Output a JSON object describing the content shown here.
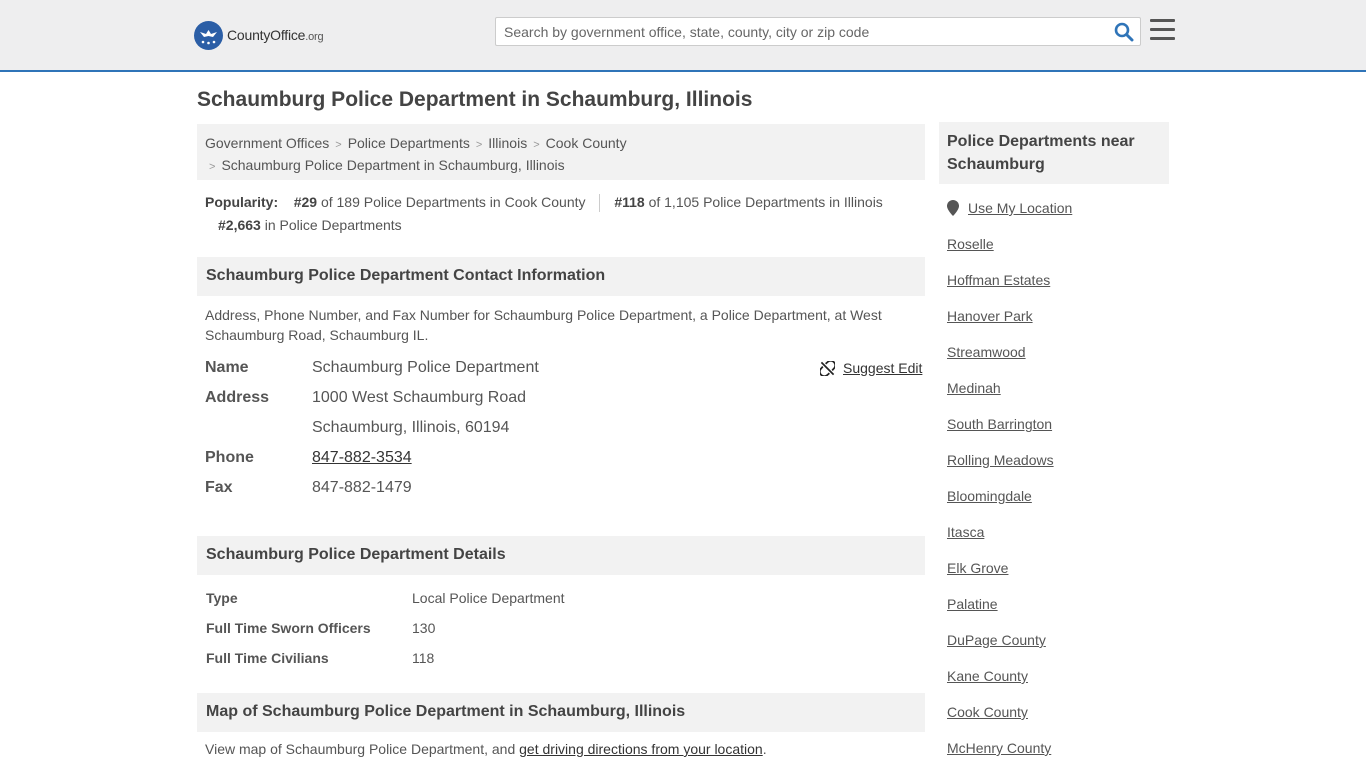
{
  "header": {
    "logo_text": "CountyOffice",
    "logo_suffix": ".org",
    "search_placeholder": "Search by government office, state, county, city or zip code"
  },
  "page_title": "Schaumburg Police Department in Schaumburg, Illinois",
  "breadcrumb": {
    "items": [
      "Government Offices",
      "Police Departments",
      "Illinois",
      "Cook County"
    ],
    "current": "Schaumburg Police Department in Schaumburg, Illinois"
  },
  "popularity": {
    "label": "Popularity:",
    "rank1": "#29",
    "rank1_text": "of 189 Police Departments in Cook County",
    "rank2": "#118",
    "rank2_text": "of 1,105 Police Departments in Illinois",
    "rank3": "#2,663",
    "rank3_text": "in Police Departments"
  },
  "contact": {
    "heading": "Schaumburg Police Department Contact Information",
    "intro": "Address, Phone Number, and Fax Number for Schaumburg Police Department, a Police Department, at West Schaumburg Road, Schaumburg IL.",
    "suggest_edit": "Suggest Edit",
    "name_label": "Name",
    "name": "Schaumburg Police Department",
    "address_label": "Address",
    "address_line1": "1000 West Schaumburg Road",
    "address_line2": "Schaumburg, Illinois, 60194",
    "phone_label": "Phone",
    "phone": "847-882-3534",
    "fax_label": "Fax",
    "fax": "847-882-1479"
  },
  "details": {
    "heading": "Schaumburg Police Department Details",
    "rows": [
      {
        "label": "Type",
        "value": "Local Police Department"
      },
      {
        "label": "Full Time Sworn Officers",
        "value": "130"
      },
      {
        "label": "Full Time Civilians",
        "value": "118"
      }
    ]
  },
  "map": {
    "heading": "Map of Schaumburg Police Department in Schaumburg, Illinois",
    "text_prefix": "View map of Schaumburg Police Department, and",
    "link": "get driving directions from your location",
    "text_suffix": "."
  },
  "sidebar": {
    "heading": "Police Departments near Schaumburg",
    "use_location": "Use My Location",
    "items": [
      "Roselle",
      "Hoffman Estates",
      "Hanover Park",
      "Streamwood",
      "Medinah",
      "South Barrington",
      "Rolling Meadows",
      "Bloomingdale",
      "Itasca",
      "Elk Grove",
      "Palatine",
      "DuPage County",
      "Kane County",
      "Cook County",
      "McHenry County"
    ]
  },
  "colors": {
    "header_bg": "#eeeeef",
    "header_border": "#2f74b8",
    "logo_blue": "#2b5ea6",
    "search_icon": "#2f74b8",
    "panel_bg": "#f2f2f2"
  },
  "icons": {
    "search": "search-icon",
    "menu": "hamburger-menu-icon",
    "suggest_edit": "unlink-icon",
    "location": "map-pin-icon"
  }
}
